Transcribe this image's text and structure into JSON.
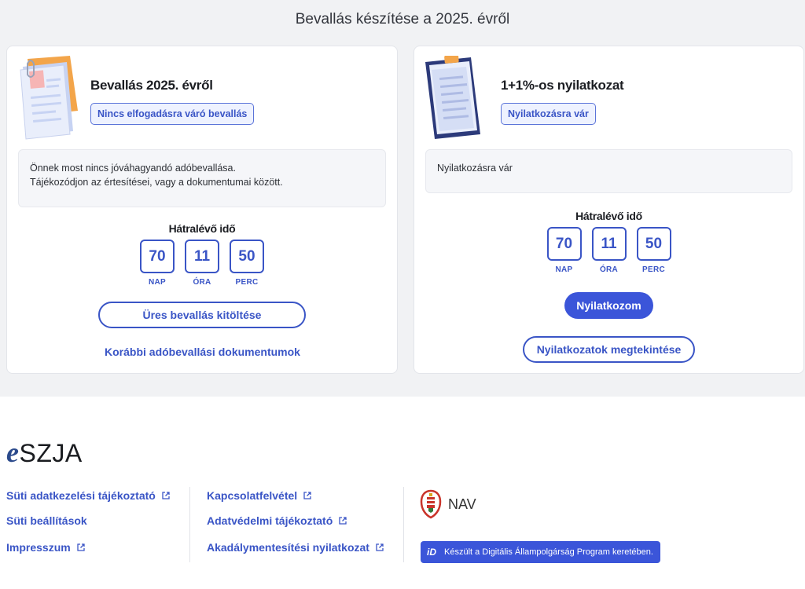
{
  "page": {
    "title": "Bevallás készítése a 2025. évről"
  },
  "tax_card": {
    "title": "Bevallás 2025. évről",
    "status_tag": "Nincs elfogadásra váró bevallás",
    "info_line1": "Önnek most nincs jóváhagyandó adóbevallása.",
    "info_line2": "Tájékozódjon az értesítései, vagy a dokumentumai között.",
    "timer_label": "Hátralévő idő",
    "timer": {
      "days": "70",
      "days_unit": "NAP",
      "hours": "11",
      "hours_unit": "ÓRA",
      "minutes": "50",
      "minutes_unit": "PERC"
    },
    "fill_button": "Üres bevallás kitöltése",
    "docs_link": "Korábbi adóbevallási dokumentumok"
  },
  "declaration_card": {
    "title": "1+1%-os nyilatkozat",
    "status_tag": "Nyilatkozásra vár",
    "info_text": "Nyilatkozásra vár",
    "timer_label": "Hátralévő idő",
    "timer": {
      "days": "70",
      "days_unit": "NAP",
      "hours": "11",
      "hours_unit": "ÓRA",
      "minutes": "50",
      "minutes_unit": "PERC"
    },
    "declare_button": "Nyilatkozom",
    "view_button": "Nyilatkozatok megtekintése"
  },
  "footer": {
    "logo_e": "e",
    "logo_rest": "SZJA",
    "links_col1": [
      "Süti adatkezelési tájékoztató",
      "Süti beállítások",
      "Impresszum"
    ],
    "links_col2": [
      "Kapcsolatfelvétel",
      "Adatvédelmi tájékoztató",
      "Akadálymentesítési nyilatkozat"
    ],
    "nav_label": "NAV",
    "dap_badge_icon": "iD",
    "dap_badge_text": "Készült a Digitális Állampolgárság Program keretében."
  },
  "colors": {
    "accent": "#3a55c6",
    "button": "#3b55d9",
    "background": "#f1f2f4"
  }
}
